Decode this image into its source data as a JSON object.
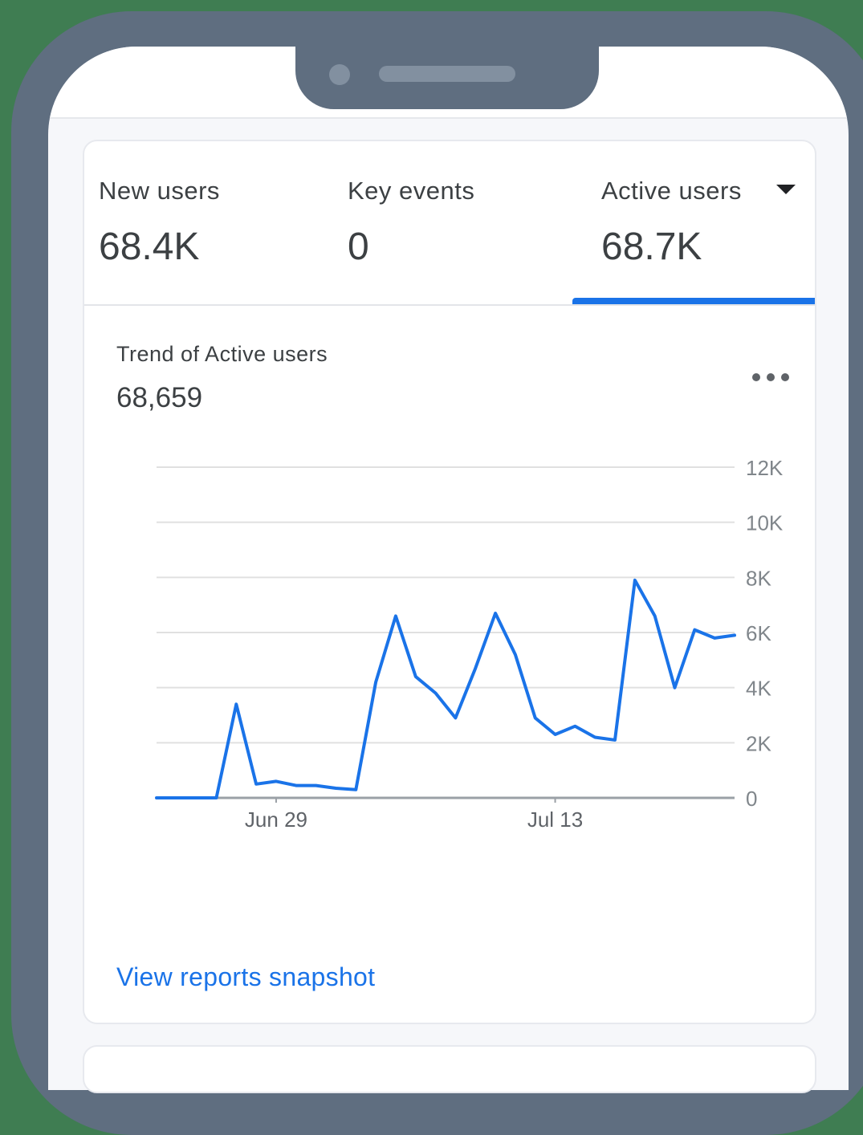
{
  "metrics": [
    {
      "label": "New users",
      "value": "68.4K"
    },
    {
      "label": "Key events",
      "value": "0"
    },
    {
      "label": "Active users",
      "value": "68.7K"
    }
  ],
  "selected_metric": "Active users",
  "trend": {
    "title": "Trend of Active users",
    "total": "68,659"
  },
  "link": {
    "label": "View reports snapshot"
  },
  "colors": {
    "accent": "#1a73e8",
    "text": "#3c4043",
    "grid": "#e0e0e0"
  },
  "chart_data": {
    "type": "line",
    "x": [
      "Jun 23",
      "Jun 24",
      "Jun 25",
      "Jun 26",
      "Jun 27",
      "Jun 28",
      "Jun 29",
      "Jun 30",
      "Jul 1",
      "Jul 2",
      "Jul 3",
      "Jul 4",
      "Jul 5",
      "Jul 6",
      "Jul 7",
      "Jul 8",
      "Jul 9",
      "Jul 10",
      "Jul 11",
      "Jul 12",
      "Jul 13",
      "Jul 14",
      "Jul 15",
      "Jul 16",
      "Jul 17",
      "Jul 18",
      "Jul 19",
      "Jul 20",
      "Jul 21",
      "Jul 22"
    ],
    "series": [
      {
        "values": [
          0,
          0,
          0,
          0,
          3400,
          500,
          600,
          450,
          450,
          350,
          300,
          4200,
          6600,
          4400,
          3800,
          2900,
          4700,
          6700,
          5200,
          2900,
          2300,
          2600,
          2200,
          2100,
          7900,
          6600,
          4000,
          6100,
          5800,
          5900
        ]
      }
    ],
    "x_tick_labels": [
      "Jun 29",
      "Jul 13"
    ],
    "y_ticks": [
      "12K",
      "10K",
      "8K",
      "6K",
      "4K",
      "2K",
      "0"
    ],
    "y_tick_values": [
      12000,
      10000,
      8000,
      6000,
      4000,
      2000,
      0
    ],
    "ylim": [
      0,
      12000
    ],
    "grid": true,
    "y_axis_position": "right",
    "title": "",
    "xlabel": "",
    "ylabel": ""
  }
}
